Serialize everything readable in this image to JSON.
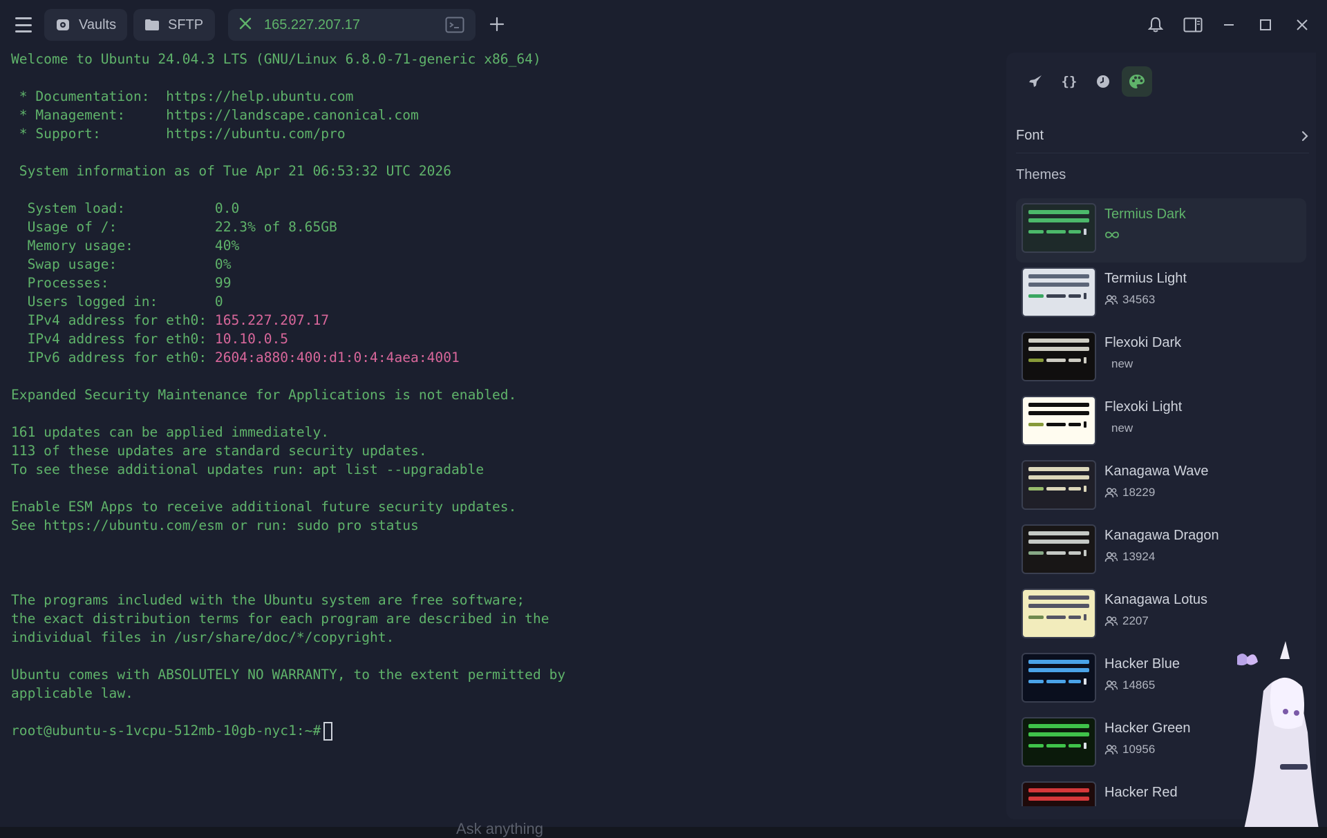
{
  "tabs": {
    "vaults": "Vaults",
    "sftp": "SFTP",
    "host": "165.227.207.17"
  },
  "terminal": {
    "lines": [
      [
        {
          "t": "Welcome to Ubuntu 24.04.3 LTS (GNU/Linux 6.8.0-71-generic x86_64)"
        }
      ],
      [
        {
          "t": ""
        }
      ],
      [
        {
          "t": " * Documentation:  https://help.ubuntu.com"
        }
      ],
      [
        {
          "t": " * Management:     https://landscape.canonical.com"
        }
      ],
      [
        {
          "t": " * Support:        https://ubuntu.com/pro"
        }
      ],
      [
        {
          "t": ""
        }
      ],
      [
        {
          "t": " System information as of Tue Apr 21 06:53:32 UTC 2026"
        }
      ],
      [
        {
          "t": ""
        }
      ],
      [
        {
          "t": "  System load:           0.0"
        }
      ],
      [
        {
          "t": "  Usage of /:            22.3% of 8.65GB"
        }
      ],
      [
        {
          "t": "  Memory usage:          40%"
        }
      ],
      [
        {
          "t": "  Swap usage:            0%"
        }
      ],
      [
        {
          "t": "  Processes:             99"
        }
      ],
      [
        {
          "t": "  Users logged in:       0"
        }
      ],
      [
        {
          "t": "  IPv4 address for eth0: "
        },
        {
          "t": "165.227.207.17",
          "c": "pink"
        }
      ],
      [
        {
          "t": "  IPv4 address for eth0: "
        },
        {
          "t": "10.10.0.5",
          "c": "pink"
        }
      ],
      [
        {
          "t": "  IPv6 address for eth0: "
        },
        {
          "t": "2604:a880:400:d1:0:4:4aea:4001",
          "c": "pink"
        }
      ],
      [
        {
          "t": ""
        }
      ],
      [
        {
          "t": "Expanded Security Maintenance for Applications is not enabled."
        }
      ],
      [
        {
          "t": ""
        }
      ],
      [
        {
          "t": "161 updates can be applied immediately."
        }
      ],
      [
        {
          "t": "113 of these updates are standard security updates."
        }
      ],
      [
        {
          "t": "To see these additional updates run: apt list --upgradable"
        }
      ],
      [
        {
          "t": ""
        }
      ],
      [
        {
          "t": "Enable ESM Apps to receive additional future security updates."
        }
      ],
      [
        {
          "t": "See https://ubuntu.com/esm or run: sudo pro status"
        }
      ],
      [
        {
          "t": ""
        }
      ],
      [
        {
          "t": ""
        }
      ],
      [
        {
          "t": ""
        }
      ],
      [
        {
          "t": "The programs included with the Ubuntu system are free software;"
        }
      ],
      [
        {
          "t": "the exact distribution terms for each program are described in the"
        }
      ],
      [
        {
          "t": "individual files in /usr/share/doc/*/copyright."
        }
      ],
      [
        {
          "t": ""
        }
      ],
      [
        {
          "t": "Ubuntu comes with ABSOLUTELY NO WARRANTY, to the extent permitted by"
        }
      ],
      [
        {
          "t": "applicable law."
        }
      ],
      [
        {
          "t": ""
        }
      ]
    ],
    "prompt": "root@ubuntu-s-1vcpu-512mb-10gb-nyc1:~#"
  },
  "panel": {
    "font_label": "Font",
    "themes_label": "Themes",
    "themes": [
      {
        "name": "Termius Dark",
        "meta": "",
        "meta_type": "infinity",
        "selected": true,
        "colors": {
          "bg": "#1e2a2a",
          "b1": "#4cb86a",
          "b2": "#4cb86a",
          "s1": "#4cb86a",
          "s2": "#4cb86a",
          "s3": "#4cb86a",
          "bar": "#cfd3dc"
        }
      },
      {
        "name": "Termius Light",
        "meta": "34563",
        "meta_type": "users",
        "selected": false,
        "colors": {
          "bg": "#dfe3ea",
          "b1": "#5c6578",
          "b2": "#5c6578",
          "s1": "#3aa661",
          "s2": "#3a4050",
          "s3": "#3a4050",
          "bar": "#3a4050"
        }
      },
      {
        "name": "Flexoki Dark",
        "meta": "new",
        "meta_type": "text",
        "selected": false,
        "colors": {
          "bg": "#100f0f",
          "b1": "#cecdc3",
          "b2": "#cecdc3",
          "s1": "#879a39",
          "s2": "#cecdc3",
          "s3": "#cecdc3",
          "bar": "#cecdc3"
        }
      },
      {
        "name": "Flexoki Light",
        "meta": "new",
        "meta_type": "text",
        "selected": false,
        "colors": {
          "bg": "#fffcf0",
          "b1": "#100f0f",
          "b2": "#100f0f",
          "s1": "#879a39",
          "s2": "#100f0f",
          "s3": "#100f0f",
          "bar": "#100f0f"
        }
      },
      {
        "name": "Kanagawa Wave",
        "meta": "18229",
        "meta_type": "users",
        "selected": false,
        "colors": {
          "bg": "#1f1f28",
          "b1": "#dcd7ba",
          "b2": "#dcd7ba",
          "s1": "#98bb6c",
          "s2": "#dcd7ba",
          "s3": "#dcd7ba",
          "bar": "#dcd7ba"
        }
      },
      {
        "name": "Kanagawa Dragon",
        "meta": "13924",
        "meta_type": "users",
        "selected": false,
        "colors": {
          "bg": "#181616",
          "b1": "#c5c9c5",
          "b2": "#c5c9c5",
          "s1": "#87a987",
          "s2": "#c5c9c5",
          "s3": "#c5c9c5",
          "bar": "#c5c9c5"
        }
      },
      {
        "name": "Kanagawa Lotus",
        "meta": "2207",
        "meta_type": "users",
        "selected": false,
        "colors": {
          "bg": "#f2ecbc",
          "b1": "#545464",
          "b2": "#545464",
          "s1": "#6f894e",
          "s2": "#545464",
          "s3": "#545464",
          "bar": "#545464"
        }
      },
      {
        "name": "Hacker Blue",
        "meta": "14865",
        "meta_type": "users",
        "selected": false,
        "colors": {
          "bg": "#0a0f1e",
          "b1": "#4aa3e8",
          "b2": "#4aa3e8",
          "s1": "#4aa3e8",
          "s2": "#4aa3e8",
          "s3": "#4aa3e8",
          "bar": "#dfe3ea"
        }
      },
      {
        "name": "Hacker Green",
        "meta": "10956",
        "meta_type": "users",
        "selected": false,
        "colors": {
          "bg": "#0b1a0b",
          "b1": "#3fc24a",
          "b2": "#3fc24a",
          "s1": "#3fc24a",
          "s2": "#3fc24a",
          "s3": "#3fc24a",
          "bar": "#dfe3ea"
        }
      },
      {
        "name": "Hacker Red",
        "meta": "",
        "meta_type": "none",
        "selected": false,
        "colors": {
          "bg": "#1e0a0a",
          "b1": "#d6383a",
          "b2": "#d6383a",
          "s1": "#d6383a",
          "s2": "#d6383a",
          "s3": "#d6383a",
          "bar": "#dfe3ea"
        }
      }
    ]
  },
  "bottom": {
    "ask_placeholder": "Ask anything"
  },
  "colors": {
    "background": "#1b1f2e",
    "terminal_text": "#5fb36a",
    "ip_highlight": "#d9679b",
    "accent_green": "#5fb36a"
  },
  "icons": {
    "menu": "hamburger-icon",
    "vaults": "vault-icon",
    "sftp": "folder-icon",
    "close_tab": "close-icon",
    "terminal": "terminal-icon",
    "new_tab": "plus-icon",
    "notifications": "bell-icon",
    "sidebar": "sidebar-toggle-icon",
    "minimize": "minimize-icon",
    "maximize": "maximize-icon",
    "close": "close-icon",
    "snippets": "rocket-icon",
    "code": "braces-icon",
    "history": "clock-icon",
    "appearance": "palette-icon"
  }
}
